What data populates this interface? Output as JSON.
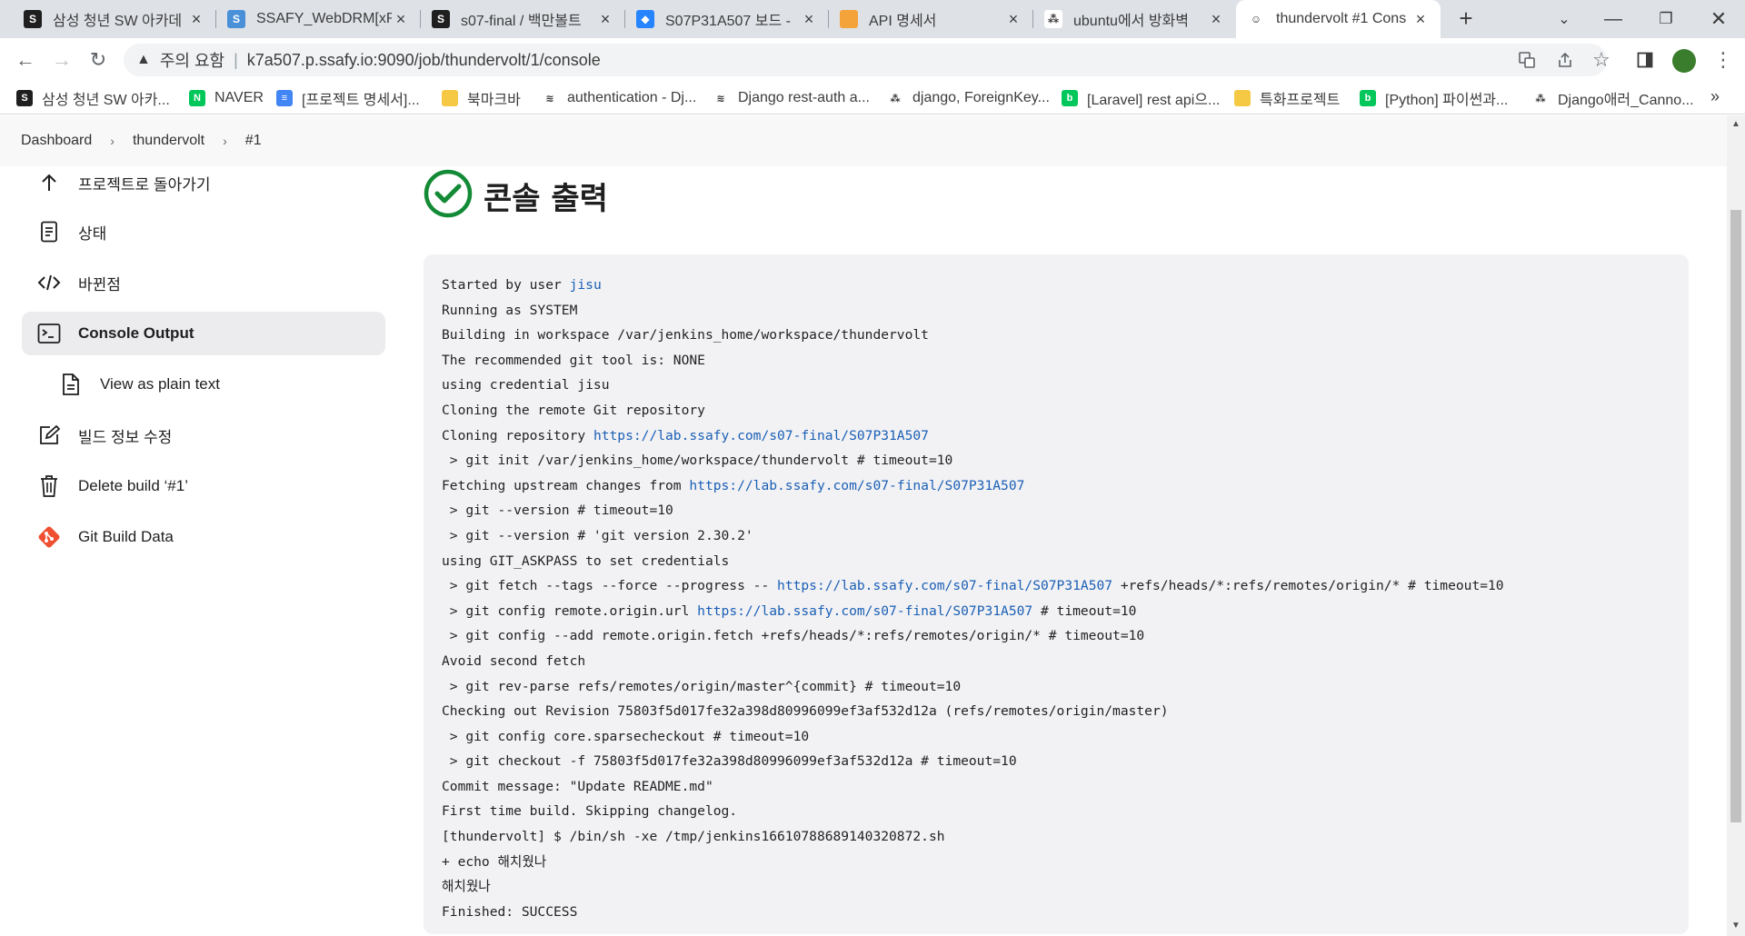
{
  "browser": {
    "tabs": [
      {
        "title": "삼성 청년 SW 아카데",
        "favicon": "ssafy-icon",
        "color": "#1f1f1f",
        "glyph": "S"
      },
      {
        "title": "SSAFY_WebDRM[xRy]",
        "favicon": "drm-icon",
        "color": "#4a90d9",
        "glyph": "S"
      },
      {
        "title": "s07-final / 백만볼트",
        "favicon": "ssafy-icon",
        "color": "#1f1f1f",
        "glyph": "S"
      },
      {
        "title": "S07P31A507 보드 -",
        "favicon": "jira-icon",
        "color": "#2684ff",
        "glyph": "◆"
      },
      {
        "title": "API 명세서",
        "favicon": "notion-page-icon",
        "color": "#f4a23a",
        "glyph": ""
      },
      {
        "title": "ubuntu에서 방화벽",
        "favicon": "git-dots-icon",
        "color": "#ffffff",
        "glyph": "⁂"
      },
      {
        "title": "thundervolt #1 Cons",
        "favicon": "jenkins-icon",
        "color": "#ffffff",
        "glyph": "☺"
      }
    ],
    "address": {
      "security_label": "주의 요함",
      "url": "k7a507.p.ssafy.io:9090/job/thundervolt/1/console"
    },
    "bookmarks": [
      {
        "label": "삼성 청년 SW 아카...",
        "icon": "ssafy-icon",
        "color": "#1f1f1f",
        "glyph": "S"
      },
      {
        "label": "NAVER",
        "icon": "naver-icon",
        "color": "#03c75a",
        "glyph": "N"
      },
      {
        "label": "[프로젝트 명세서]...",
        "icon": "docs-icon",
        "color": "#4285f4",
        "glyph": "≡"
      },
      {
        "label": "북마크바",
        "icon": "folder-icon",
        "color": "#f6c945",
        "glyph": ""
      },
      {
        "label": "authentication - Dj...",
        "icon": "stack-icon",
        "color": "#ffffff",
        "glyph": "≋"
      },
      {
        "label": "Django rest-auth a...",
        "icon": "stack-icon",
        "color": "#ffffff",
        "glyph": "≋"
      },
      {
        "label": "django, ForeignKey...",
        "icon": "dots-icon",
        "color": "#ffffff",
        "glyph": "⁂"
      },
      {
        "label": "[Laravel] rest api으...",
        "icon": "blog-icon",
        "color": "#03c75a",
        "glyph": "b"
      },
      {
        "label": "특화프로젝트",
        "icon": "folder-icon",
        "color": "#f6c945",
        "glyph": ""
      },
      {
        "label": "[Python] 파이썬과...",
        "icon": "blog-icon",
        "color": "#03c75a",
        "glyph": "b"
      },
      {
        "label": "Django애러_Canno...",
        "icon": "dots-icon",
        "color": "#ffffff",
        "glyph": "⁂"
      }
    ],
    "bookmarks_more": "»"
  },
  "breadcrumb": {
    "items": [
      "Dashboard",
      "thundervolt",
      "#1"
    ],
    "separator": "›"
  },
  "sidebar": {
    "items": [
      {
        "label": "프로젝트로 돌아가기",
        "icon": "arrow-up-icon"
      },
      {
        "label": "상태",
        "icon": "document-icon"
      },
      {
        "label": "바뀐점",
        "icon": "code-icon"
      },
      {
        "label": "Console Output",
        "icon": "terminal-icon"
      },
      {
        "label": "View as plain text",
        "icon": "file-icon"
      },
      {
        "label": "빌드 정보 수정",
        "icon": "edit-icon"
      },
      {
        "label": "Delete build ‘#1’",
        "icon": "trash-icon"
      },
      {
        "label": "Git Build Data",
        "icon": "git-icon"
      }
    ]
  },
  "main": {
    "title": "콘솔 출력",
    "status_color": "#138a36",
    "console_lines": [
      [
        {
          "t": "Started by user "
        },
        {
          "t": "jisu",
          "link": true
        }
      ],
      [
        {
          "t": "Running as SYSTEM"
        }
      ],
      [
        {
          "t": "Building in workspace /var/jenkins_home/workspace/thundervolt"
        }
      ],
      [
        {
          "t": "The recommended git tool is: NONE"
        }
      ],
      [
        {
          "t": "using credential jisu"
        }
      ],
      [
        {
          "t": "Cloning the remote Git repository"
        }
      ],
      [
        {
          "t": "Cloning repository "
        },
        {
          "t": "https://lab.ssafy.com/s07-final/S07P31A507",
          "link": true
        }
      ],
      [
        {
          "t": " > git init /var/jenkins_home/workspace/thundervolt # timeout=10"
        }
      ],
      [
        {
          "t": "Fetching upstream changes from "
        },
        {
          "t": "https://lab.ssafy.com/s07-final/S07P31A507",
          "link": true
        }
      ],
      [
        {
          "t": " > git --version # timeout=10"
        }
      ],
      [
        {
          "t": " > git --version # 'git version 2.30.2'"
        }
      ],
      [
        {
          "t": "using GIT_ASKPASS to set credentials"
        }
      ],
      [
        {
          "t": " > git fetch --tags --force --progress -- "
        },
        {
          "t": "https://lab.ssafy.com/s07-final/S07P31A507",
          "link": true
        },
        {
          "t": " +refs/heads/*:refs/remotes/origin/* # timeout=10"
        }
      ],
      [
        {
          "t": " > git config remote.origin.url "
        },
        {
          "t": "https://lab.ssafy.com/s07-final/S07P31A507",
          "link": true
        },
        {
          "t": " # timeout=10"
        }
      ],
      [
        {
          "t": " > git config --add remote.origin.fetch +refs/heads/*:refs/remotes/origin/* # timeout=10"
        }
      ],
      [
        {
          "t": "Avoid second fetch"
        }
      ],
      [
        {
          "t": " > git rev-parse refs/remotes/origin/master^{commit} # timeout=10"
        }
      ],
      [
        {
          "t": "Checking out Revision 75803f5d017fe32a398d80996099ef3af532d12a (refs/remotes/origin/master)"
        }
      ],
      [
        {
          "t": " > git config core.sparsecheckout # timeout=10"
        }
      ],
      [
        {
          "t": " > git checkout -f 75803f5d017fe32a398d80996099ef3af532d12a # timeout=10"
        }
      ],
      [
        {
          "t": "Commit message: \"Update README.md\""
        }
      ],
      [
        {
          "t": "First time build. Skipping changelog."
        }
      ],
      [
        {
          "t": "[thundervolt] $ /bin/sh -xe /tmp/jenkins16610788689140320872.sh"
        }
      ],
      [
        {
          "t": "+ echo 해치웠나"
        }
      ],
      [
        {
          "t": "해치웠나"
        }
      ],
      [
        {
          "t": "Finished: SUCCESS"
        }
      ]
    ]
  }
}
